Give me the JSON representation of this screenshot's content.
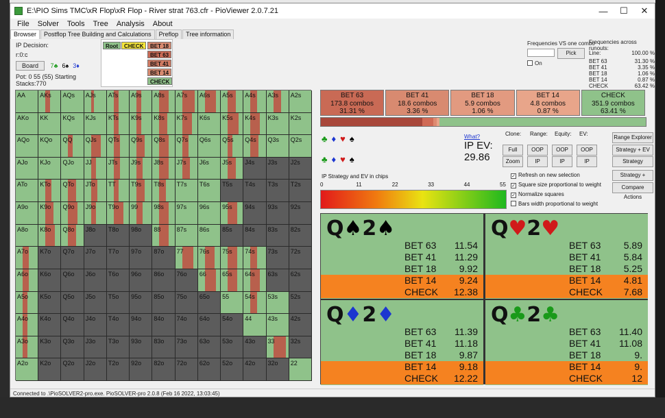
{
  "window": {
    "title": "E:\\PIO Sims TMC\\xR Flop\\xR Flop - River strat 763.cfr - PioViewer 2.0.7.21",
    "minimize": "—",
    "maximize": "☐",
    "close": "✕"
  },
  "menu": [
    "File",
    "Solver",
    "Tools",
    "Tree",
    "Analysis",
    "About"
  ],
  "tabs": [
    "Browser",
    "Postflop Tree Building and Calculations",
    "Preflop",
    "Tree information"
  ],
  "info": {
    "decision": "IP Decision:",
    "line": "r:0:c",
    "board_button": "Board",
    "board_cards": [
      {
        "rank": "7",
        "suit": "♣",
        "cls": "card-g"
      },
      {
        "rank": "6",
        "suit": "♠",
        "cls": "card-s"
      },
      {
        "rank": "3",
        "suit": "♦",
        "cls": "card-b"
      }
    ],
    "pot": "Pot: 0 55 (55) Starting Stacks:770"
  },
  "tree_nodes": {
    "root": "Root",
    "check": "CHECK",
    "b18": "BET 18",
    "b63": "BET 63",
    "b41": "BET 41",
    "b14": "BET 14",
    "check2": "CHECK"
  },
  "right_info": {
    "freq_vs_combo": "Frequencies VS one combo",
    "pick": "Pick",
    "on": "On",
    "freq_runouts": "Frequencies across runouts:",
    "line_label": "Line:",
    "line_value": "100.00 %",
    "rows": [
      {
        "name": "BET 63",
        "value": "31.30 %"
      },
      {
        "name": "BET 41",
        "value": "3.35 %"
      },
      {
        "name": "BET 18",
        "value": "1.06 %"
      },
      {
        "name": "BET 14",
        "value": "0.87 %"
      },
      {
        "name": "CHECK",
        "value": "63.42 %"
      }
    ]
  },
  "actions": [
    {
      "name": "BET 63",
      "combos": "173.8 combos",
      "pct": "31.31 %",
      "color": "#c96a55"
    },
    {
      "name": "BET 41",
      "combos": "18.6 combos",
      "pct": "3.36 %",
      "color": "#d88a70"
    },
    {
      "name": "BET 18",
      "combos": "5.9 combos",
      "pct": "1.06 %",
      "color": "#e29a80"
    },
    {
      "name": "BET 14",
      "combos": "4.8 combos",
      "pct": "0.87 %",
      "color": "#e8a58a"
    },
    {
      "name": "CHECK",
      "combos": "351.9 combos",
      "pct": "63.41 %",
      "color": "#8fc28a"
    }
  ],
  "freq_segments": [
    {
      "frac": 0.3131,
      "color": "#a8473a"
    },
    {
      "frac": 0.0336,
      "color": "#d06a55"
    },
    {
      "frac": 0.0106,
      "color": "#de8a70"
    },
    {
      "frac": 0.0087,
      "color": "#e8a58a"
    },
    {
      "frac": 0.6341,
      "color": "#8fc28a"
    }
  ],
  "suit_rows": [
    [
      {
        "s": "♣",
        "cls": "card-g"
      },
      {
        "s": "♦",
        "cls": "card-b"
      },
      {
        "s": "♥",
        "cls": "card-r"
      },
      {
        "s": "♠",
        "cls": "card-s"
      }
    ],
    [
      {
        "s": "♣",
        "cls": "card-g"
      },
      {
        "s": "♦",
        "cls": "card-b"
      },
      {
        "s": "♥",
        "cls": "card-r"
      },
      {
        "s": "♠",
        "cls": "card-s"
      }
    ]
  ],
  "ipev": {
    "what": "What?",
    "label": "IP EV:",
    "value": "29.86"
  },
  "controls": {
    "clone": "Clone:",
    "range": "Range:",
    "equity": "Equity:",
    "ev": "EV:",
    "full": "Full",
    "zoom": "Zoom",
    "oop1": "OOP",
    "ip1": "IP",
    "oop2": "OOP",
    "ip2": "IP",
    "oop3": "OOP",
    "ip3": "IP",
    "range_explorer": "Range Explorer",
    "strategy_ev": "Strategy + EV",
    "strategy": "Strategy",
    "strategy_react": "Strategy + React",
    "compare_actions": "Compare Actions",
    "cb1": "Refresh on new selection",
    "cb2": "Square size proportional to weight",
    "cb3": "Normalize squares",
    "cb4": "Bars width proportional to weight"
  },
  "legend_label": "IP Strategy and EV in chips",
  "scale_ticks": [
    "0",
    "11",
    "22",
    "33",
    "44",
    "55"
  ],
  "ranks": [
    "A",
    "K",
    "Q",
    "J",
    "T",
    "9",
    "8",
    "7",
    "6",
    "5",
    "4",
    "3",
    "2"
  ],
  "grid_rows": [
    [
      "AA",
      "AKs",
      "AQs",
      "AJs",
      "ATs",
      "A9s",
      "A8s",
      "A7s",
      "A6s",
      "A5s",
      "A4s",
      "A3s",
      "A2s"
    ],
    [
      "AKo",
      "KK",
      "KQs",
      "KJs",
      "KTs",
      "K9s",
      "K8s",
      "K7s",
      "K6s",
      "K5s",
      "K4s",
      "K3s",
      "K2s"
    ],
    [
      "AQo",
      "KQo",
      "QQ",
      "QJs",
      "QTs",
      "Q9s",
      "Q8s",
      "Q7s",
      "Q6s",
      "Q5s",
      "Q4s",
      "Q3s",
      "Q2s"
    ],
    [
      "AJo",
      "KJo",
      "QJo",
      "JJ",
      "JTs",
      "J9s",
      "J8s",
      "J7s",
      "J6s",
      "J5s",
      "J4s",
      "J3s",
      "J2s"
    ],
    [
      "ATo",
      "KTo",
      "QTo",
      "JTo",
      "TT",
      "T9s",
      "T8s",
      "T7s",
      "T6s",
      "T5s",
      "T4s",
      "T3s",
      "T2s"
    ],
    [
      "A9o",
      "K9o",
      "Q9o",
      "J9o",
      "T9o",
      "99",
      "98s",
      "97s",
      "96s",
      "95s",
      "94s",
      "93s",
      "92s"
    ],
    [
      "A8o",
      "K8o",
      "Q8o",
      "J8o",
      "T8o",
      "98o",
      "88",
      "87s",
      "86s",
      "85s",
      "84s",
      "83s",
      "82s"
    ],
    [
      "A7o",
      "K7o",
      "Q7o",
      "J7o",
      "T7o",
      "97o",
      "87o",
      "77",
      "76s",
      "75s",
      "74s",
      "73s",
      "72s"
    ],
    [
      "A6o",
      "K6o",
      "Q6o",
      "J6o",
      "T6o",
      "96o",
      "86o",
      "76o",
      "66",
      "65s",
      "64s",
      "63s",
      "62s"
    ],
    [
      "A5o",
      "K5o",
      "Q5o",
      "J5o",
      "T5o",
      "95o",
      "85o",
      "75o",
      "65o",
      "55",
      "54s",
      "53s",
      "52s"
    ],
    [
      "A4o",
      "K4o",
      "Q4o",
      "J4o",
      "T4o",
      "94o",
      "84o",
      "74o",
      "64o",
      "54o",
      "44",
      "43s",
      "42s"
    ],
    [
      "A3o",
      "K3o",
      "Q3o",
      "J3o",
      "T3o",
      "93o",
      "83o",
      "73o",
      "63o",
      "53o",
      "43o",
      "33",
      "32s"
    ],
    [
      "A2o",
      "K2o",
      "Q2o",
      "J2o",
      "T2o",
      "92o",
      "82o",
      "72o",
      "62o",
      "52o",
      "42o",
      "32o",
      "22"
    ]
  ],
  "grid_bet": [
    [
      0.0,
      0.3,
      0.0,
      0.2,
      0.3,
      0.3,
      0.6,
      0.8,
      0.7,
      0.5,
      0.4,
      0.5,
      0.0
    ],
    [
      0.0,
      0.0,
      0.0,
      0.0,
      0.3,
      0.3,
      0.5,
      0.6,
      0.0,
      0.7,
      0.6,
      0.0,
      0.0
    ],
    [
      0.0,
      0.0,
      0.3,
      0.6,
      0.4,
      0.5,
      0.6,
      0.4,
      0.0,
      0.3,
      0.5,
      0.0,
      0.0
    ],
    [
      0.0,
      0.0,
      0.0,
      0.3,
      0.4,
      0.4,
      0.6,
      0.5,
      0.0,
      0.5,
      0.0,
      0.0,
      0.0
    ],
    [
      0.0,
      0.4,
      0.5,
      0.4,
      0.3,
      0.5,
      0.4,
      0.0,
      0.0,
      0.0,
      0.0,
      0.0,
      0.0
    ],
    [
      0.0,
      0.5,
      0.6,
      0.3,
      0.6,
      0.4,
      0.6,
      0.0,
      0.0,
      0.6,
      0.0,
      0.0,
      0.0
    ],
    [
      0.0,
      0.6,
      0.5,
      0.0,
      0.0,
      0.0,
      0.6,
      0.0,
      0.0,
      0.0,
      0.0,
      0.0,
      0.0
    ],
    [
      0.4,
      0.0,
      0.0,
      0.0,
      0.0,
      0.0,
      0.0,
      0.7,
      0.6,
      0.6,
      0.4,
      0.0,
      0.0
    ],
    [
      0.4,
      0.0,
      0.0,
      0.0,
      0.0,
      0.0,
      0.0,
      0.0,
      0.7,
      0.6,
      0.6,
      0.0,
      0.0
    ],
    [
      0.3,
      0.0,
      0.0,
      0.0,
      0.0,
      0.0,
      0.0,
      0.0,
      0.0,
      0.0,
      0.4,
      0.0,
      0.0
    ],
    [
      0.3,
      0.0,
      0.0,
      0.0,
      0.0,
      0.0,
      0.0,
      0.0,
      0.0,
      0.0,
      0.0,
      0.0,
      0.0
    ],
    [
      0.3,
      0.0,
      0.0,
      0.0,
      0.0,
      0.0,
      0.0,
      0.0,
      0.0,
      0.0,
      0.0,
      0.8,
      0.0
    ],
    [
      0.0,
      0.0,
      0.0,
      0.0,
      0.0,
      0.0,
      0.0,
      0.0,
      0.0,
      0.0,
      0.0,
      0.0,
      0.0
    ]
  ],
  "grid_active": [
    [
      1,
      1,
      1,
      1,
      1,
      1,
      1,
      1,
      1,
      1,
      1,
      1,
      1
    ],
    [
      1,
      1,
      1,
      1,
      1,
      1,
      1,
      1,
      1,
      1,
      1,
      1,
      1
    ],
    [
      1,
      1,
      1,
      1,
      1,
      1,
      1,
      1,
      1,
      1,
      1,
      1,
      1
    ],
    [
      1,
      1,
      1,
      1,
      1,
      1,
      1,
      1,
      1,
      1,
      0,
      0,
      0
    ],
    [
      1,
      1,
      1,
      1,
      1,
      1,
      1,
      1,
      1,
      0,
      0,
      0,
      0
    ],
    [
      1,
      1,
      1,
      1,
      1,
      1,
      1,
      1,
      1,
      1,
      0,
      0,
      0
    ],
    [
      1,
      1,
      1,
      0,
      0,
      0,
      1,
      1,
      1,
      0,
      0,
      0,
      0
    ],
    [
      1,
      0,
      0,
      0,
      0,
      0,
      0,
      1,
      1,
      1,
      1,
      0,
      0
    ],
    [
      1,
      0,
      0,
      0,
      0,
      0,
      0,
      0,
      1,
      1,
      1,
      0,
      0
    ],
    [
      1,
      0,
      0,
      0,
      0,
      0,
      0,
      0,
      0,
      1,
      1,
      1,
      0
    ],
    [
      1,
      0,
      0,
      0,
      0,
      0,
      0,
      0,
      0,
      0,
      1,
      1,
      0
    ],
    [
      1,
      0,
      0,
      0,
      0,
      0,
      0,
      0,
      0,
      0,
      0,
      1,
      0
    ],
    [
      1,
      0,
      0,
      0,
      0,
      0,
      0,
      0,
      0,
      0,
      0,
      0,
      1
    ]
  ],
  "combos": [
    {
      "name": "Q♠2♠",
      "r1": "Q",
      "s1": "♠",
      "r2": "2",
      "s2": "♠",
      "cls": "card-s",
      "rows": [
        {
          "a": "BET 63",
          "v": "11.54"
        },
        {
          "a": "BET 41",
          "v": "11.29"
        },
        {
          "a": "BET 18",
          "v": "9.92"
        },
        {
          "a": "BET 14",
          "v": "9.24",
          "hl": true
        },
        {
          "a": "CHECK",
          "v": "12.38",
          "hl": true
        }
      ]
    },
    {
      "name": "Q♥2♥",
      "r1": "Q",
      "s1": "♥",
      "r2": "2",
      "s2": "♥",
      "cls": "card-r",
      "rows": [
        {
          "a": "BET 63",
          "v": "5.89"
        },
        {
          "a": "BET 41",
          "v": "5.84"
        },
        {
          "a": "BET 18",
          "v": "5.25"
        },
        {
          "a": "BET 14",
          "v": "4.81",
          "hl": true
        },
        {
          "a": "CHECK",
          "v": "7.68",
          "hl": true
        }
      ]
    },
    {
      "name": "Q♦2♦",
      "r1": "Q",
      "s1": "♦",
      "r2": "2",
      "s2": "♦",
      "cls": "card-b",
      "rows": [
        {
          "a": "BET 63",
          "v": "11.39"
        },
        {
          "a": "BET 41",
          "v": "11.18"
        },
        {
          "a": "BET 18",
          "v": "9.87"
        },
        {
          "a": "BET 14",
          "v": "9.18",
          "hl": true
        },
        {
          "a": "CHECK",
          "v": "12.22",
          "hl": true
        }
      ]
    },
    {
      "name": "Q♣2♣",
      "r1": "Q",
      "s1": "♣",
      "r2": "2",
      "s2": "♣",
      "cls": "card-g",
      "rows": [
        {
          "a": "BET 63",
          "v": "11.40"
        },
        {
          "a": "BET 41",
          "v": "11.08"
        },
        {
          "a": "BET 18",
          "v": "9."
        },
        {
          "a": "BET 14",
          "v": "9.",
          "hl": true
        },
        {
          "a": "CHECK",
          "v": "12",
          "hl": true
        }
      ]
    }
  ],
  "status": "Connected to .\\PioSOLVER2-pro.exe. PioSOLVER-pro 2.0.8 (Feb 16 2022, 13:03:45)",
  "colors": {
    "bet": "#b8604d",
    "check": "#8fc28a",
    "inactive": "#5c5c5c",
    "highlight": "#f58220"
  }
}
